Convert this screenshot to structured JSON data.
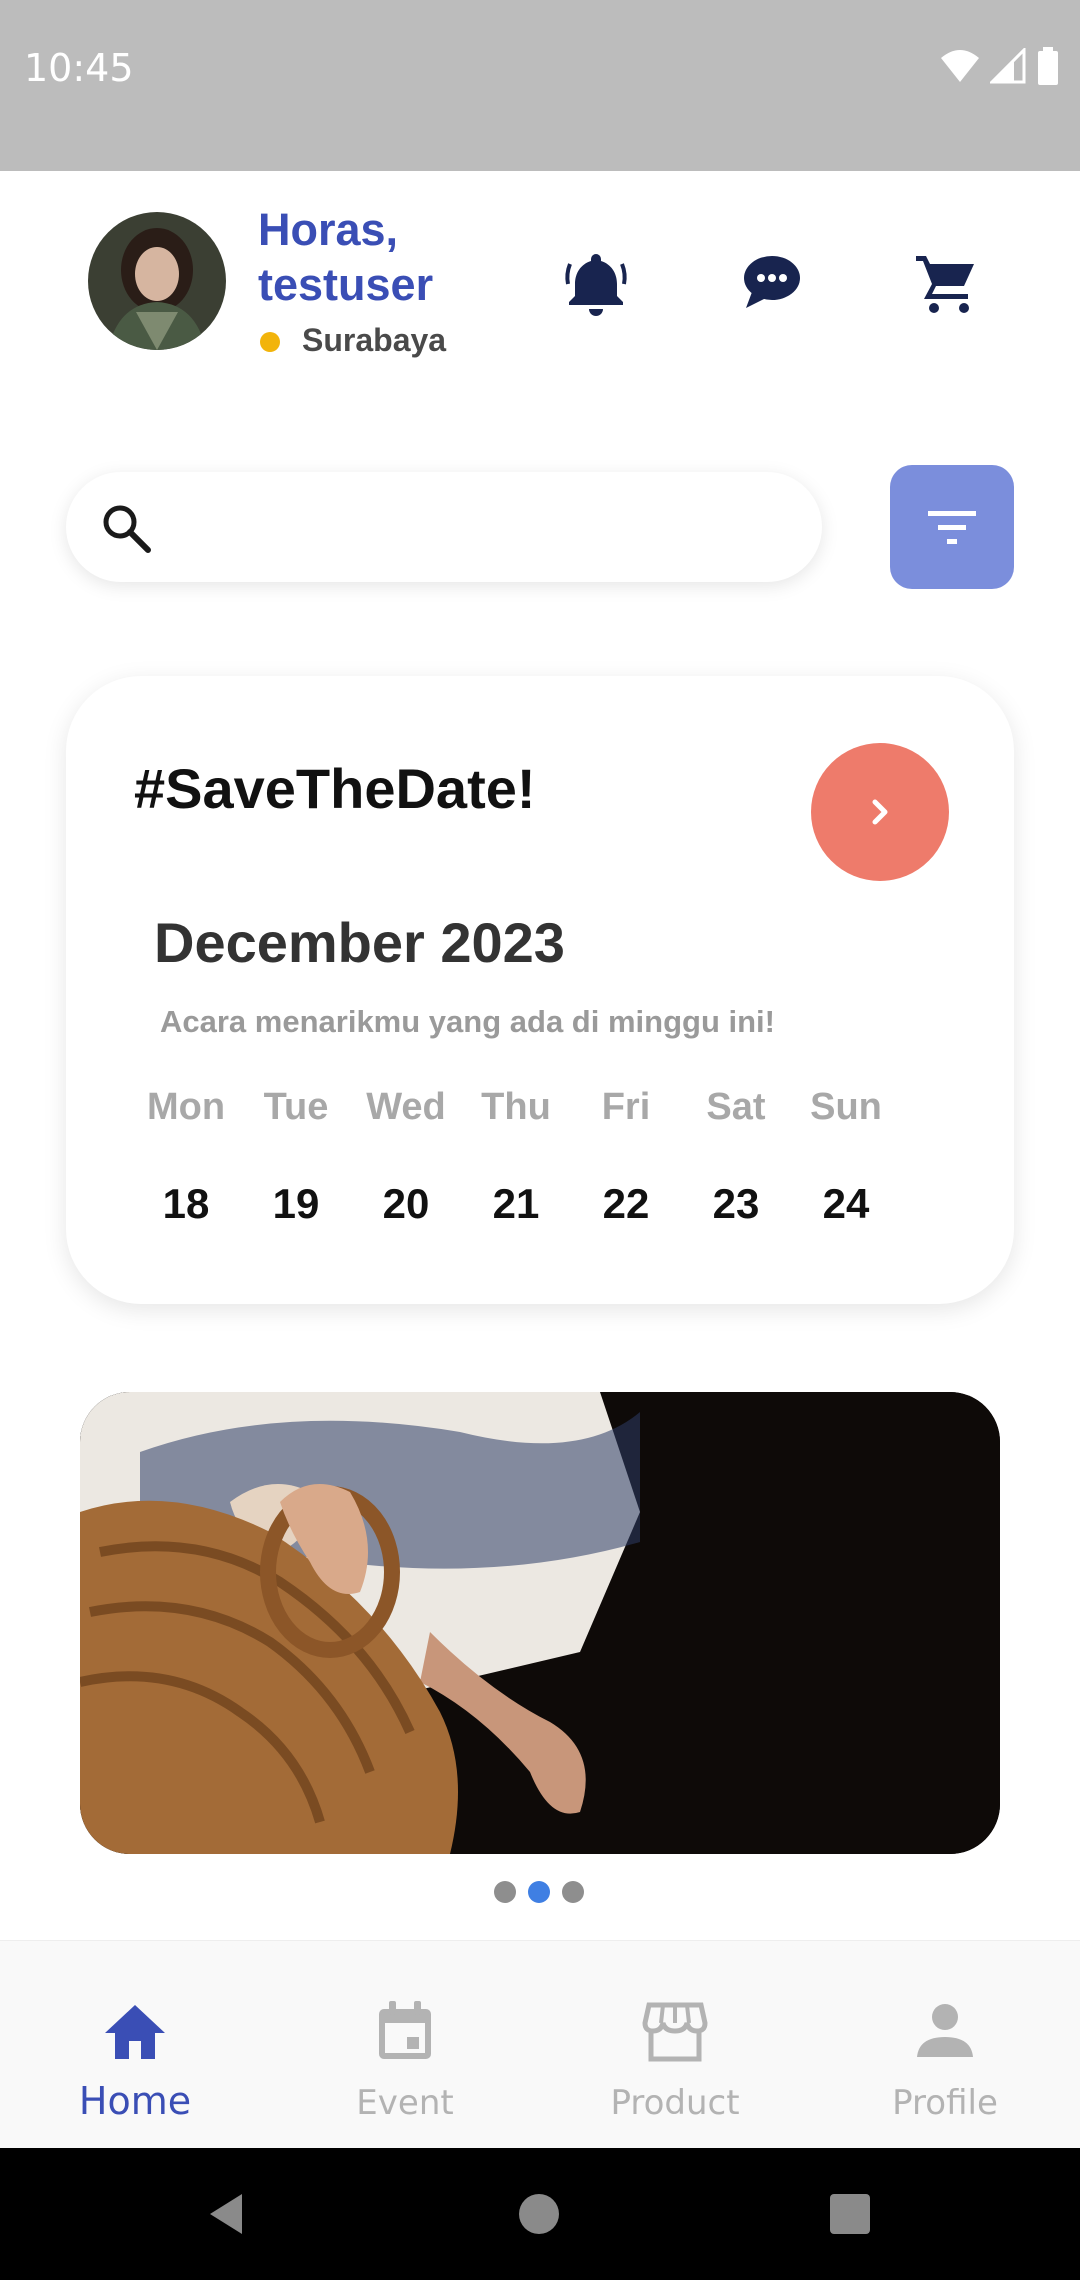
{
  "status_bar": {
    "time": "10:45"
  },
  "header": {
    "greeting": "Horas, testuser",
    "location": "Surabaya",
    "colors": {
      "brand": "#3a4eb5",
      "location_dot": "#f2b40b"
    }
  },
  "search": {
    "placeholder": "",
    "value": ""
  },
  "date_card": {
    "title": "#SaveTheDate!",
    "month": "December 2023",
    "subtitle": "Acara menarikmu yang ada di minggu ini!",
    "days": [
      {
        "name": "Mon",
        "num": "18"
      },
      {
        "name": "Tue",
        "num": "19"
      },
      {
        "name": "Wed",
        "num": "20"
      },
      {
        "name": "Thu",
        "num": "21"
      },
      {
        "name": "Fri",
        "num": "22"
      },
      {
        "name": "Sat",
        "num": "23"
      },
      {
        "name": "Sun",
        "num": "24"
      }
    ],
    "accent_color": "#ee7b6b"
  },
  "carousel": {
    "total_pages": 3,
    "active_page": 2
  },
  "bottom_nav": {
    "items": [
      {
        "label": "Home",
        "icon": "home-icon",
        "active": true
      },
      {
        "label": "Event",
        "icon": "calendar-icon",
        "active": false
      },
      {
        "label": "Product",
        "icon": "store-icon",
        "active": false
      },
      {
        "label": "Profile",
        "icon": "person-icon",
        "active": false
      }
    ]
  }
}
